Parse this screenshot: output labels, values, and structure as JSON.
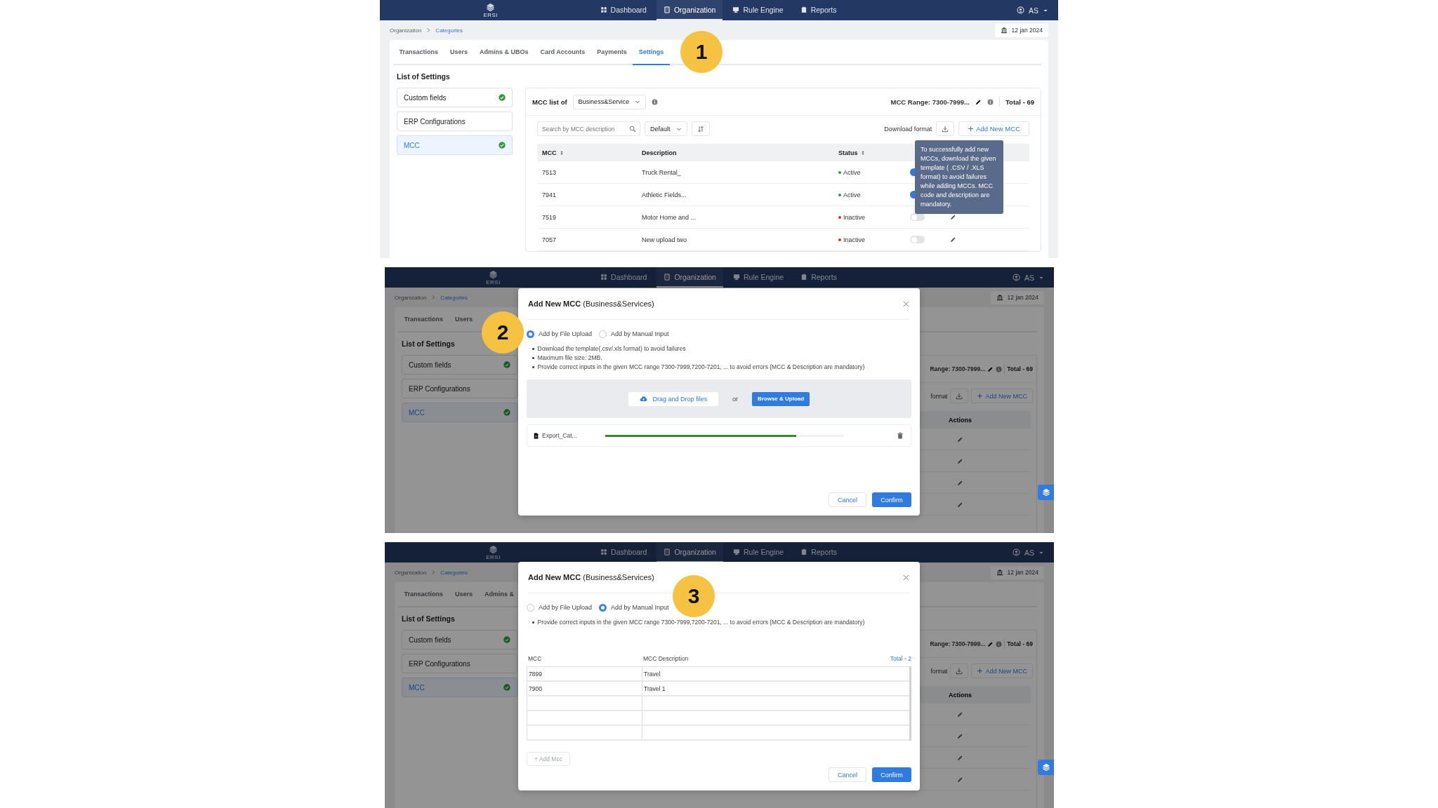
{
  "screens": [
    {
      "kind": "settings_page",
      "callout": "1",
      "nav": {
        "logo": "ERSI",
        "items": [
          {
            "label": "Dashboard",
            "selected": false
          },
          {
            "label": "Organization",
            "selected": true
          },
          {
            "label": "Rule Engine",
            "selected": false
          },
          {
            "label": "Reports",
            "selected": false
          }
        ],
        "user": "AS"
      },
      "breadcrumb": [
        {
          "label": "Organization",
          "current": false
        },
        {
          "label": "Categories",
          "current": true
        }
      ],
      "date": "12 jan 2024",
      "tabs": [
        {
          "label": "Transactions",
          "selected": false
        },
        {
          "label": "Users",
          "selected": false
        },
        {
          "label": "Admins & UBOs",
          "selected": false
        },
        {
          "label": "Card Accounts",
          "selected": false
        },
        {
          "label": "Payments",
          "selected": false
        },
        {
          "label": "Settings",
          "selected": true
        }
      ],
      "settings_title": "List of Settings",
      "settings": [
        {
          "label": "Custom fields",
          "checked": true,
          "selected": false
        },
        {
          "label": "ERP Configurations",
          "checked": false,
          "selected": false
        },
        {
          "label": "MCC",
          "checked": true,
          "selected": true
        }
      ],
      "mcc_header": {
        "label": "MCC list of",
        "category": "Business&Service",
        "range": "MCC Range: 7300-7999...",
        "total": "Total - 69"
      },
      "toolbar": {
        "search_placeholder": "Search by MCC description",
        "sort": "Default",
        "download_label": "Download format",
        "add_button": "Add New MCC"
      },
      "table": {
        "columns": [
          {
            "label": "MCC"
          },
          {
            "label": "Description"
          },
          {
            "label": "Status"
          }
        ],
        "rows": [
          {
            "mcc": "7513",
            "description": "Truck Rental_",
            "status": "Active",
            "active": true,
            "edit_visible": false
          },
          {
            "mcc": "7941",
            "description": "Athletic Fields...",
            "status": "Active",
            "active": true,
            "edit_visible": false
          },
          {
            "mcc": "7519",
            "description": "Motor Home and ...",
            "status": "Inactive",
            "active": false,
            "edit_visible": true
          },
          {
            "mcc": "7057",
            "description": "New upload two",
            "status": "Inactive",
            "active": false,
            "edit_visible": true
          }
        ]
      },
      "tooltip": "To successfully add new MCCs, download the given template ( .CSV / .XLS format) to avoid failures while adding MCCs. MCC code and description are mandatory."
    },
    {
      "kind": "upload_modal",
      "callout": "2",
      "nav": {
        "logo": "ERSI",
        "items": [
          {
            "label": "Dashboard",
            "selected": false
          },
          {
            "label": "Organization",
            "selected": true
          },
          {
            "label": "Rule Engine",
            "selected": false
          },
          {
            "label": "Reports",
            "selected": false
          }
        ],
        "user": "AS"
      },
      "breadcrumb": [
        {
          "label": "Organization",
          "current": false
        },
        {
          "label": "Categories",
          "current": true
        }
      ],
      "date": "12 jan 2024",
      "tabs": [
        {
          "label": "Transactions",
          "selected": false
        },
        {
          "label": "Users",
          "selected": false
        }
      ],
      "settings_title": "List of Settings",
      "settings": [
        {
          "label": "Custom fields",
          "checked": true,
          "selected": false
        },
        {
          "label": "ERP Configurations",
          "checked": false,
          "selected": false
        },
        {
          "label": "MCC",
          "checked": true,
          "selected": true
        }
      ],
      "strip": {
        "range": "Range: 7300-7999...",
        "total": "Total - 69",
        "download_label": "format",
        "add_button": "Add New MCC",
        "actions_column": "Actions"
      },
      "modal": {
        "title": "**Add New MCC** (Business&Services)",
        "options": [
          {
            "label": "Add by File Upload",
            "selected": true
          },
          {
            "label": "Add by Manual Input",
            "selected": false
          }
        ],
        "notes": [
          "Download the template(.csv/.xls format) to avoid failures",
          "Maximum file size: 2MB.",
          "Provide correct inputs in the given MCC range 7300-7999,7200-7201, ... to avoid errors (MCC & Description are mandatory)"
        ],
        "dropzone": {
          "drag_button": "Drag and Drop files",
          "separator": "or",
          "browse_button": "Browse & Upload"
        },
        "file": {
          "name": "Export_Cat...",
          "level": 0.8
        },
        "cancel": "Cancel",
        "confirm": "Confirm"
      }
    },
    {
      "kind": "manual_modal",
      "callout": "3",
      "nav": {
        "logo": "ERSI",
        "items": [
          {
            "label": "Dashboard",
            "selected": false
          },
          {
            "label": "Organization",
            "selected": true
          },
          {
            "label": "Rule Engine",
            "selected": false
          },
          {
            "label": "Reports",
            "selected": false
          }
        ],
        "user": "AS"
      },
      "breadcrumb": [
        {
          "label": "Organization",
          "current": false
        },
        {
          "label": "Categories",
          "current": true
        }
      ],
      "date": "12 jan 2024",
      "tabs": [
        {
          "label": "Transactions",
          "selected": false
        },
        {
          "label": "Users",
          "selected": false
        },
        {
          "label": "Admins &",
          "selected": false
        }
      ],
      "settings_title": "List of Settings",
      "settings": [
        {
          "label": "Custom fields",
          "checked": true,
          "selected": false
        },
        {
          "label": "ERP Configurations",
          "checked": false,
          "selected": false
        },
        {
          "label": "MCC",
          "checked": true,
          "selected": true
        }
      ],
      "strip": {
        "range": "Range: 7300-7999...",
        "total": "Total - 69",
        "download_label": "format",
        "add_button": "Add New MCC",
        "actions_column": "Actions"
      },
      "modal": {
        "title": "**Add New MCC** (Business&Services)",
        "options": [
          {
            "label": "Add by File Upload",
            "selected": false
          },
          {
            "label": "Add by Manual Input",
            "selected": true
          }
        ],
        "notes": [
          "Provide correct inputs in the given MCC range 7300-7999,7200-7201, ... to avoid errors (MCC & Description are mandatory)"
        ],
        "entry_table": {
          "columns": [
            "MCC",
            "MCC Description"
          ],
          "total": "Total - 2",
          "rows": [
            {
              "mcc": "7899",
              "description": "Travel"
            },
            {
              "mcc": "7900",
              "description": "Travel 1"
            }
          ]
        },
        "add_row_button": {
          "label": "+ Add Mcc",
          "disabled": true
        },
        "cancel": "Cancel",
        "confirm": "Confirm"
      }
    }
  ]
}
